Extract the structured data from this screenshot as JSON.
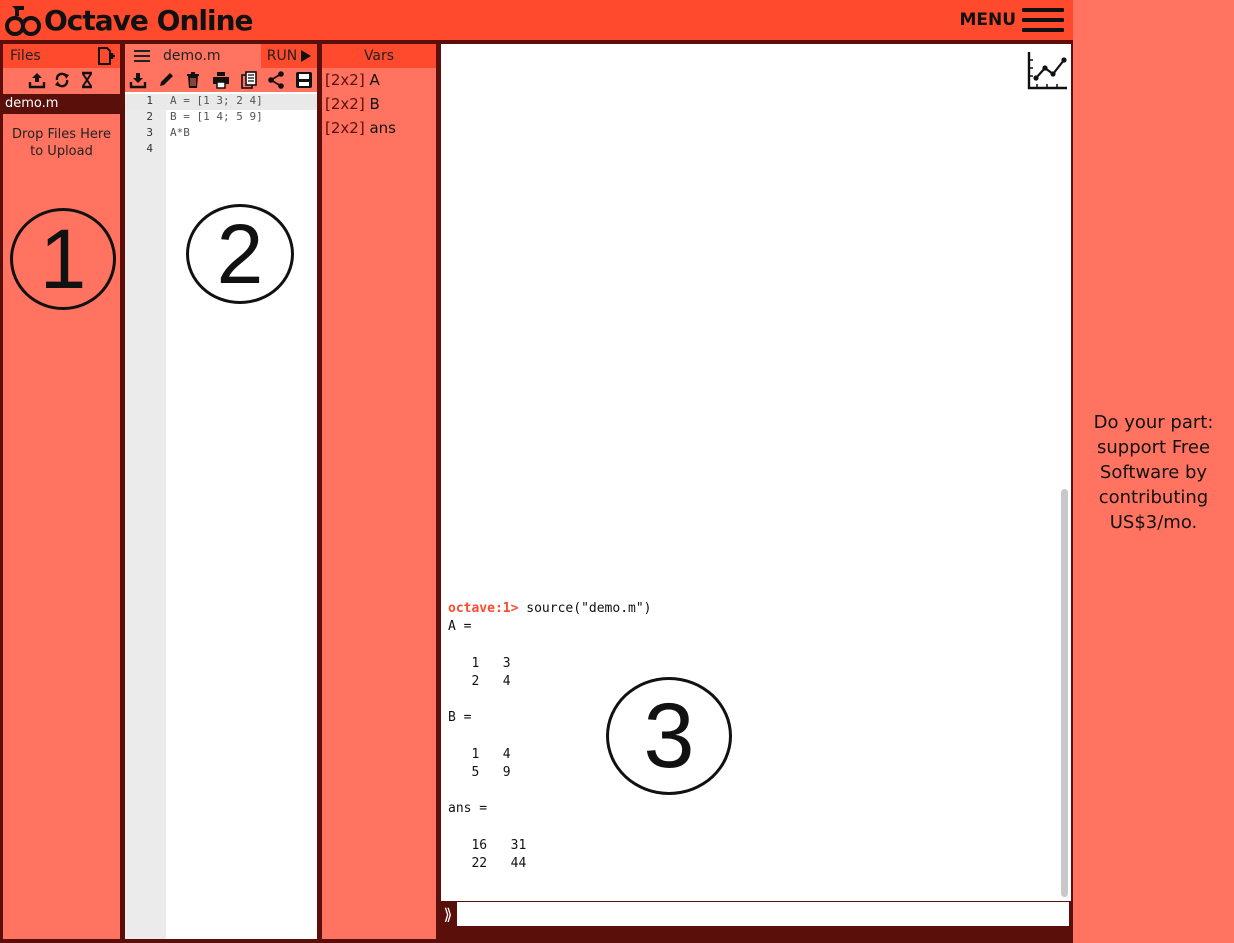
{
  "header": {
    "brand": "Octave Online",
    "menu_label": "MENU"
  },
  "files_panel": {
    "title": "Files",
    "tools": [
      "upload-icon",
      "refresh-icon",
      "hourglass-icon"
    ],
    "files": [
      "demo.m"
    ],
    "drop_hint_line1": "Drop Files Here",
    "drop_hint_line2": "to Upload"
  },
  "editor": {
    "filename": "demo.m",
    "run_label": "RUN",
    "tools": [
      "download-icon",
      "pencil-icon",
      "trash-icon",
      "print-icon",
      "copy-icon",
      "share-icon",
      "save-icon"
    ],
    "lines": [
      {
        "num": "1",
        "code": "A = [1 3; 2 4]"
      },
      {
        "num": "2",
        "code": "B = [1 4; 5 9]"
      },
      {
        "num": "3",
        "code": "A*B"
      },
      {
        "num": "4",
        "code": ""
      }
    ]
  },
  "vars_panel": {
    "title": "Vars",
    "items": [
      {
        "size": "[2x2]",
        "name": "A"
      },
      {
        "size": "[2x2]",
        "name": "B"
      },
      {
        "size": "[2x2]",
        "name": "ans"
      }
    ]
  },
  "console": {
    "prompt": "octave:1>",
    "command": " source(\"demo.m\")",
    "output": "A =\n\n   1   3\n   2   4\n\nB =\n\n   1   4\n   5   9\n\nans =\n\n   16   31\n   22   44",
    "input_chevron": "⟫",
    "input_value": ""
  },
  "annotations": {
    "c1": "1",
    "c2": "2",
    "c3": "3"
  },
  "ad": {
    "line1": "Do your part:",
    "line2": "support Free",
    "line3": "Software by",
    "line4": "contributing",
    "line5": "US$3/mo."
  },
  "colors": {
    "accent": "#ff4a2e",
    "panel": "#ff7360",
    "dark": "#5a0f0a"
  }
}
